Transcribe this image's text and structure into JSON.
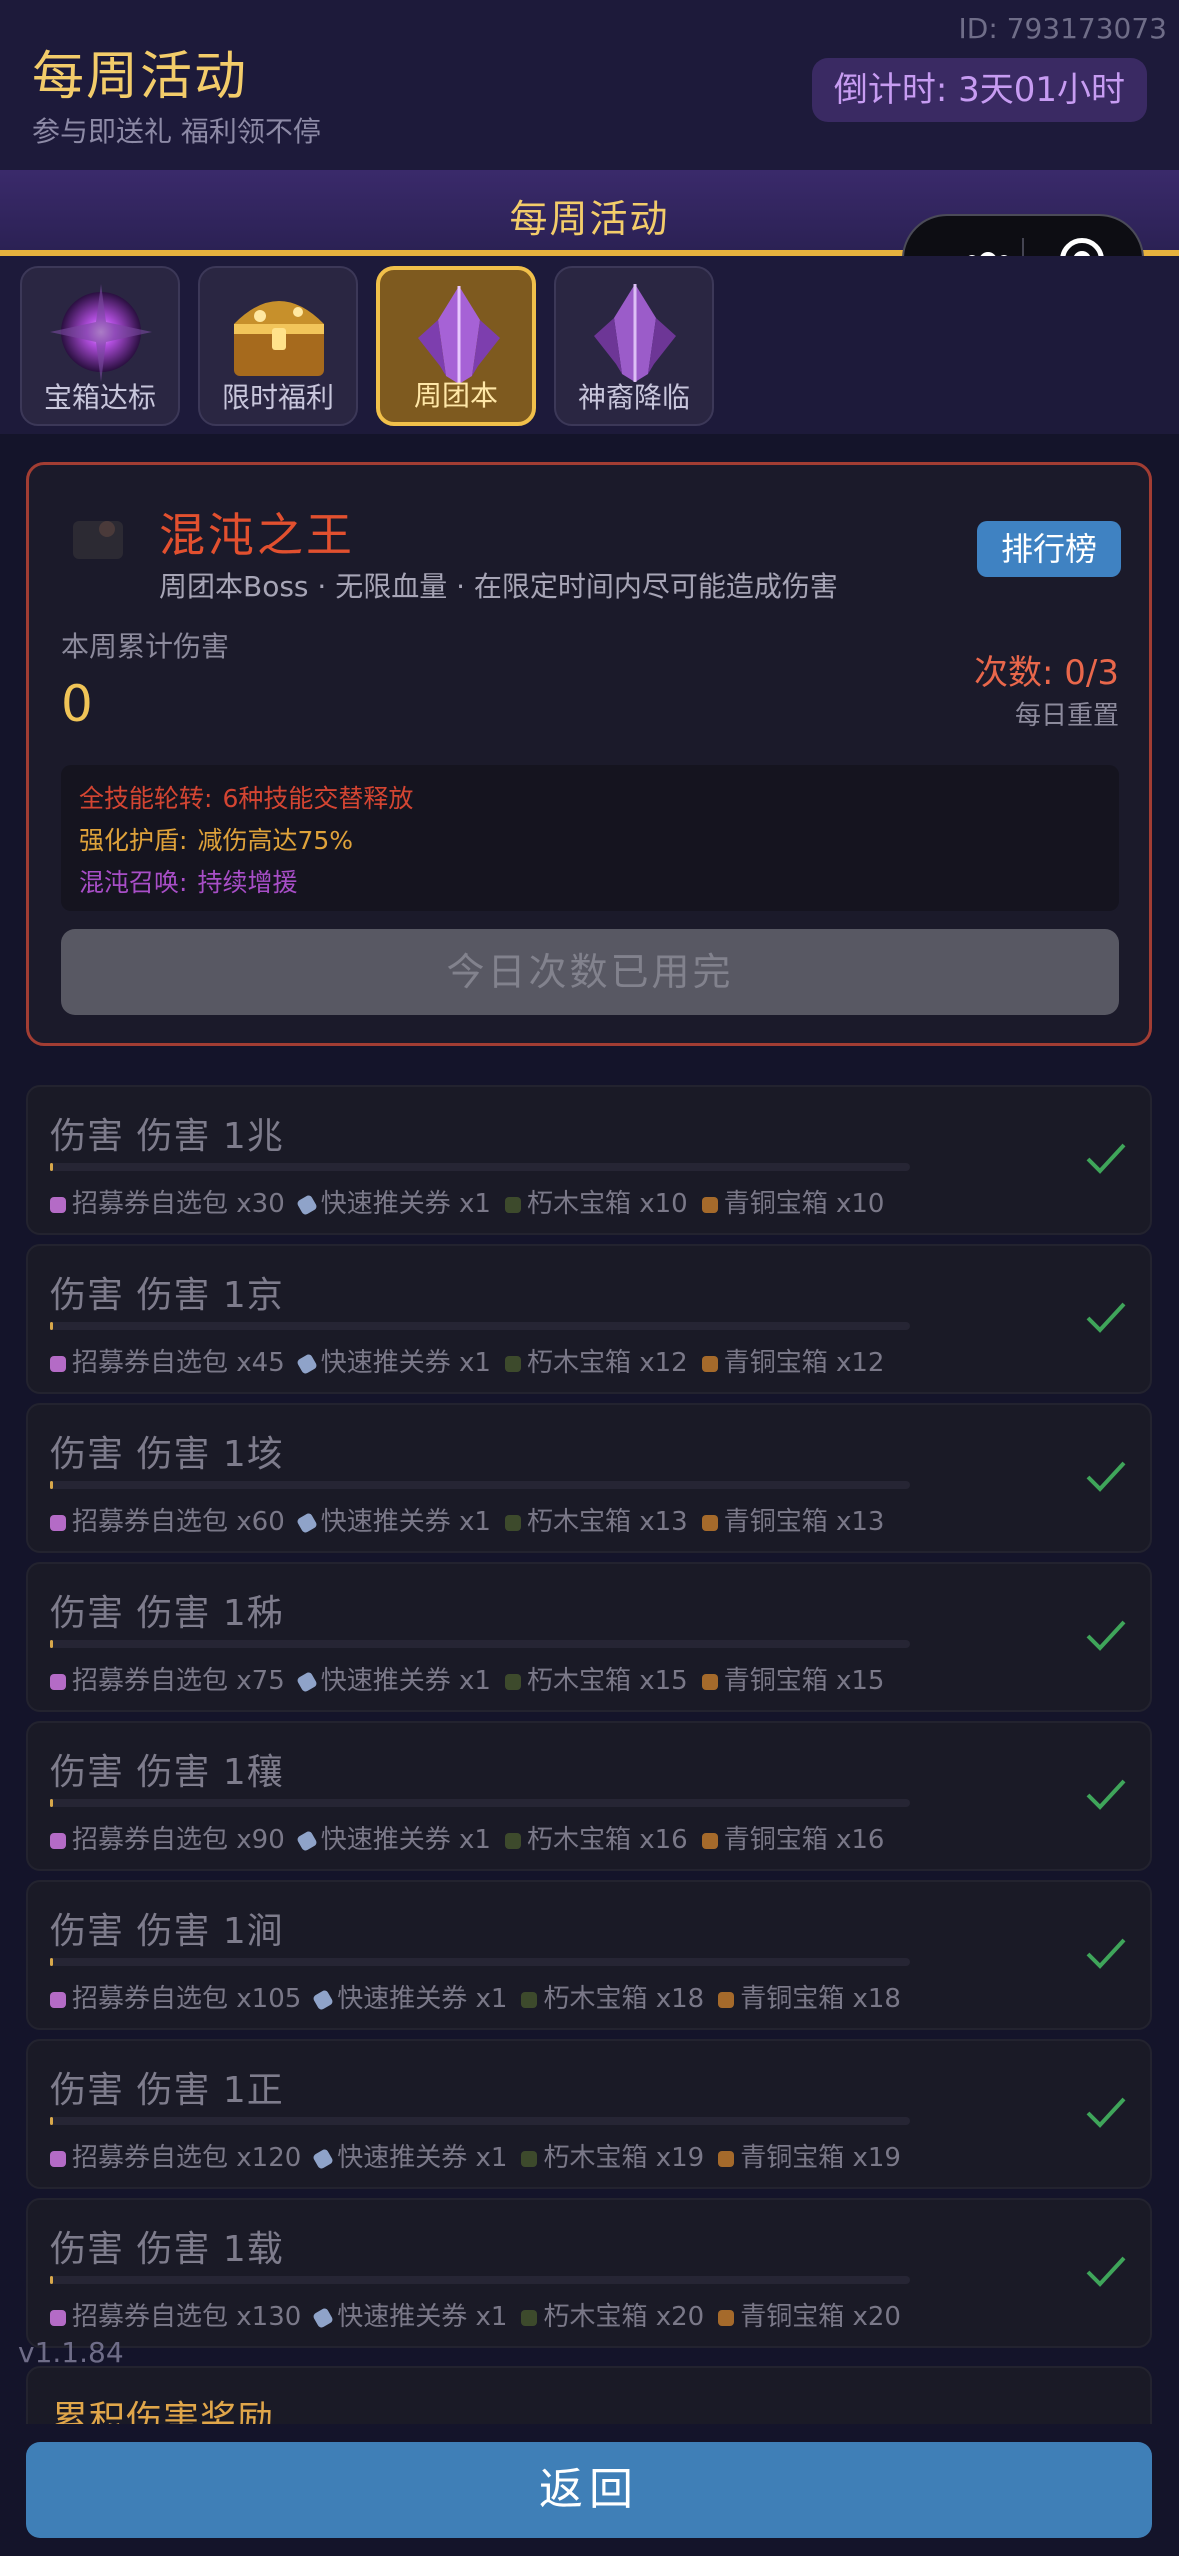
{
  "header": {
    "title": "每周活动",
    "subtitle": "参与即送礼 福利领不停",
    "user_id": "ID: 793173073",
    "countdown_label": "倒计时: ",
    "countdown_value": "3天01小时"
  },
  "section_title": "每周活动",
  "tabs": [
    {
      "label": "宝箱达标",
      "icon": "purple-orb-icon"
    },
    {
      "label": "限时福利",
      "icon": "treasure-chest-icon"
    },
    {
      "label": "周团本",
      "icon": "purple-crystal-icon",
      "active": true
    },
    {
      "label": "神裔降临",
      "icon": "purple-crystal-icon"
    }
  ],
  "boss": {
    "name": "混沌之王",
    "description": "周团本Boss · 无限血量 · 在限定时间内尽可能造成伤害",
    "rank_button": "排行榜",
    "damage_label": "本周累计伤害",
    "damage_value": "0",
    "attempts": "次数: 0/3",
    "reset": "每日重置",
    "skills": [
      {
        "key": "全技能轮转:",
        "value": "6种技能交替释放"
      },
      {
        "key": "强化护盾:",
        "value": "减伤高达75%"
      },
      {
        "key": "混沌召唤:",
        "value": "持续增援"
      }
    ],
    "action_button": "今日次数已用完"
  },
  "rewards": [
    {
      "title": "伤害 伤害 1兆",
      "items": [
        "招募券自选包 x30",
        "快速推关券 x1",
        "朽木宝箱 x10",
        "青铜宝箱 x10"
      ]
    },
    {
      "title": "伤害 伤害 1京",
      "items": [
        "招募券自选包 x45",
        "快速推关券 x1",
        "朽木宝箱 x12",
        "青铜宝箱 x12"
      ]
    },
    {
      "title": "伤害 伤害 1垓",
      "items": [
        "招募券自选包 x60",
        "快速推关券 x1",
        "朽木宝箱 x13",
        "青铜宝箱 x13"
      ]
    },
    {
      "title": "伤害 伤害 1秭",
      "items": [
        "招募券自选包 x75",
        "快速推关券 x1",
        "朽木宝箱 x15",
        "青铜宝箱 x15"
      ]
    },
    {
      "title": "伤害 伤害 1穰",
      "items": [
        "招募券自选包 x90",
        "快速推关券 x1",
        "朽木宝箱 x16",
        "青铜宝箱 x16"
      ]
    },
    {
      "title": "伤害 伤害 1涧",
      "items": [
        "招募券自选包 x105",
        "快速推关券 x1",
        "朽木宝箱 x18",
        "青铜宝箱 x18"
      ]
    },
    {
      "title": "伤害 伤害 1正",
      "items": [
        "招募券自选包 x120",
        "快速推关券 x1",
        "朽木宝箱 x19",
        "青铜宝箱 x19"
      ]
    },
    {
      "title": "伤害 伤害 1载",
      "items": [
        "招募券自选包 x130",
        "快速推关券 x1",
        "朽木宝箱 x20",
        "青铜宝箱 x20"
      ]
    }
  ],
  "reward_progress": 0,
  "item_icons": [
    "ticket-pack-icon",
    "scroll-icon",
    "wooden-chest-icon",
    "bronze-chest-icon"
  ],
  "cumulative_title": "累积伤害奖励",
  "version": "v1.1.84",
  "back_button": "返回",
  "colors": {
    "accent_gold": "#f3cc6a",
    "boss_red": "#e2502f",
    "rank_blue": "#3f82c2",
    "check_green": "#3fa55a"
  }
}
